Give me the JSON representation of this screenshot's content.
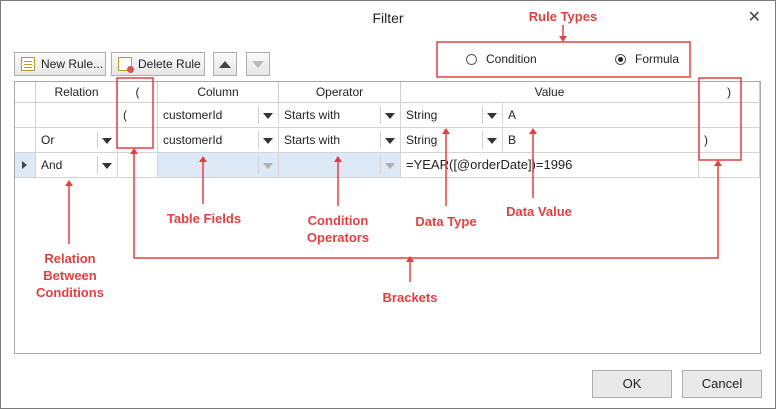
{
  "window": {
    "title": "Filter",
    "close_glyph": "✕"
  },
  "toolbar": {
    "new_rule_label": "New Rule...",
    "delete_rule_label": "Delete Rule",
    "new_icon": "new-rule-icon",
    "delete_icon": "delete-rule-icon",
    "move_up_icon": "arrow-up-icon",
    "move_down_icon": "arrow-down-icon"
  },
  "rule_type": {
    "options": [
      {
        "label": "Condition",
        "selected": false
      },
      {
        "label": "Formula",
        "selected": true
      }
    ]
  },
  "grid": {
    "columns": [
      "Relation",
      "(",
      "Column",
      "Operator",
      "Value",
      ")"
    ],
    "rows": [
      {
        "relation": "",
        "open": "(",
        "column": "customerId",
        "operator": "Starts with",
        "type": "String",
        "value": "A",
        "close": ""
      },
      {
        "relation": "Or",
        "open": "",
        "column": "customerId",
        "operator": "Starts with",
        "type": "String",
        "value": "B",
        "close": ")"
      },
      {
        "relation": "And",
        "open": "",
        "column": "",
        "operator": "",
        "type": "",
        "value": "=YEAR([@orderDate])=1996",
        "close": ""
      }
    ]
  },
  "footer": {
    "ok_label": "OK",
    "cancel_label": "Cancel"
  },
  "annotations": {
    "rule_types": "Rule Types",
    "table_fields": "Table Fields",
    "condition_operators_1": "Condition",
    "condition_operators_2": "Operators",
    "data_type": "Data Type",
    "data_value": "Data Value",
    "relation_1": "Relation",
    "relation_2": "Between",
    "relation_3": "Conditions",
    "brackets": "Brackets",
    "color": "#e04040"
  }
}
